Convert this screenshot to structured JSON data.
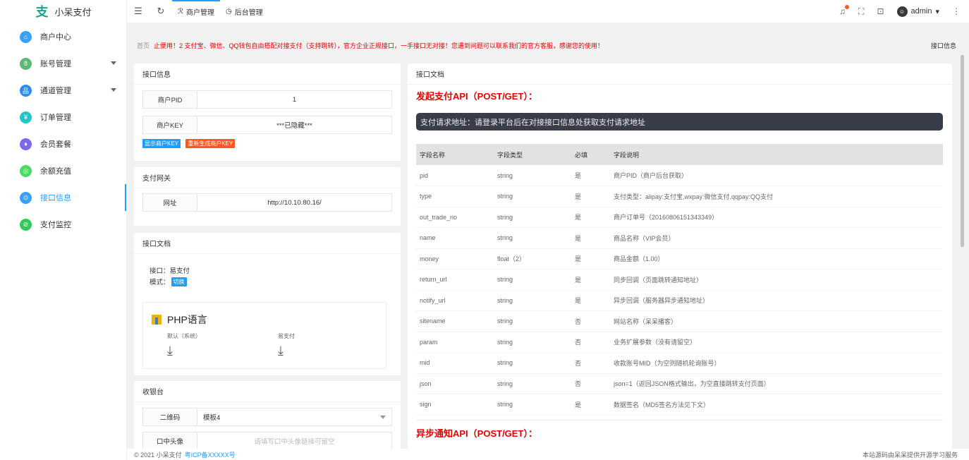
{
  "app": {
    "title": "小呆支付"
  },
  "sidebar": {
    "items": [
      {
        "label": "商户中心",
        "color": "#3aa0ff",
        "icon": "home-icon",
        "glyph": "⌂"
      },
      {
        "label": "账号管理",
        "color": "#5fb878",
        "icon": "user-icon",
        "glyph": "8",
        "expandable": true
      },
      {
        "label": "通道管理",
        "color": "#2d8cf0",
        "icon": "grid-icon",
        "glyph": "品",
        "expandable": true
      },
      {
        "label": "订单管理",
        "color": "#23c6c8",
        "icon": "cart-icon",
        "glyph": "¥"
      },
      {
        "label": "会员套餐",
        "color": "#7b68ee",
        "icon": "diamond-icon",
        "glyph": "♦"
      },
      {
        "label": "余额充值",
        "color": "#4cd964",
        "icon": "coin-icon",
        "glyph": "◎"
      },
      {
        "label": "接口信息",
        "color": "#3aa0ff",
        "icon": "info-icon",
        "glyph": "⊙",
        "active": true
      },
      {
        "label": "支付监控",
        "color": "#34c759",
        "icon": "monitor-icon",
        "glyph": "⊘"
      }
    ]
  },
  "topbar": {
    "tabs": [
      {
        "label": "商户管理",
        "icon": "person-icon",
        "glyph": "ℛ",
        "active": true
      },
      {
        "label": "后台管理",
        "icon": "dashboard-icon",
        "glyph": "◷"
      }
    ],
    "user": "admin"
  },
  "notice": {
    "home": "首页",
    "text": "止便用！2 支付宝、微信、QQ钱包自由搭配对接支付（支持跳转），官方企业正规接口，一手接口无对接！您遇到问题可以联系我们的官方客服，感谢您的使用！",
    "right": "接口信息"
  },
  "api_info": {
    "title": "接口信息",
    "pid_label": "商户PID",
    "pid_value": "1",
    "key_label": "商户KEY",
    "key_value": "***已隐藏***",
    "show_key_btn": "显示商户KEY",
    "regen_key_btn": "重新生成商户KEY"
  },
  "gateway": {
    "title": "支付网关",
    "url_label": "网址",
    "url_value": "http://10.10.80.16/"
  },
  "doc_left": {
    "title": "接口文档",
    "iface": "接口：易支付",
    "mode_label": "模式：",
    "mode_btn": "切换",
    "lang": "PHP语言",
    "dl1": "默认（系统）",
    "dl2": "易支付"
  },
  "cashier": {
    "title": "收银台",
    "qr_label": "二维码",
    "qr_value": "模板4",
    "avatar_label": "口中头像",
    "avatar_placeholder": "请填写口中头像链接可留空"
  },
  "doc_right": {
    "header": "接口文档",
    "title": "发起支付API（POST/GET）：",
    "url_text": "支付请求地址：请登录平台后在对接接口信息处获取支付请求地址",
    "columns": [
      "字段名称",
      "字段类型",
      "必填",
      "字段说明"
    ],
    "rows": [
      [
        "pid",
        "string",
        "是",
        "商户PID（商户后台获取）"
      ],
      [
        "type",
        "string",
        "是",
        "支付类型：alipay:支付宝,wxpay:微信支付,qqpay:QQ支付"
      ],
      [
        "out_trade_no",
        "string",
        "是",
        "商户订单号（20160806151343349）"
      ],
      [
        "name",
        "string",
        "是",
        "商品名称（VIP会员）"
      ],
      [
        "money",
        "float（2）",
        "是",
        "商品金额（1.00）"
      ],
      [
        "return_url",
        "string",
        "是",
        "同步回调（页面跳转通知地址）"
      ],
      [
        "notify_url",
        "string",
        "是",
        "异步回调（服务器异步通知地址）"
      ],
      [
        "sitename",
        "string",
        "否",
        "网站名称（呆呆播客）"
      ],
      [
        "param",
        "string",
        "否",
        "业务扩展参数（没有请留空）"
      ],
      [
        "mid",
        "string",
        "否",
        "收款账号MID（为空则随机轮询账号）"
      ],
      [
        "json",
        "string",
        "否",
        "json=1（返回JSON格式输出，为空直接跳转支付页面）"
      ],
      [
        "sign",
        "string",
        "是",
        "数据签名（MD5签名方法见下文）"
      ]
    ],
    "async_title": "异步通知API（POST/GET）："
  },
  "footer": {
    "copyright": "© 2021 小呆支付",
    "icp": "粤ICP备XXXXX号",
    "right": "本站源码由呆呆提供开源学习服务"
  }
}
